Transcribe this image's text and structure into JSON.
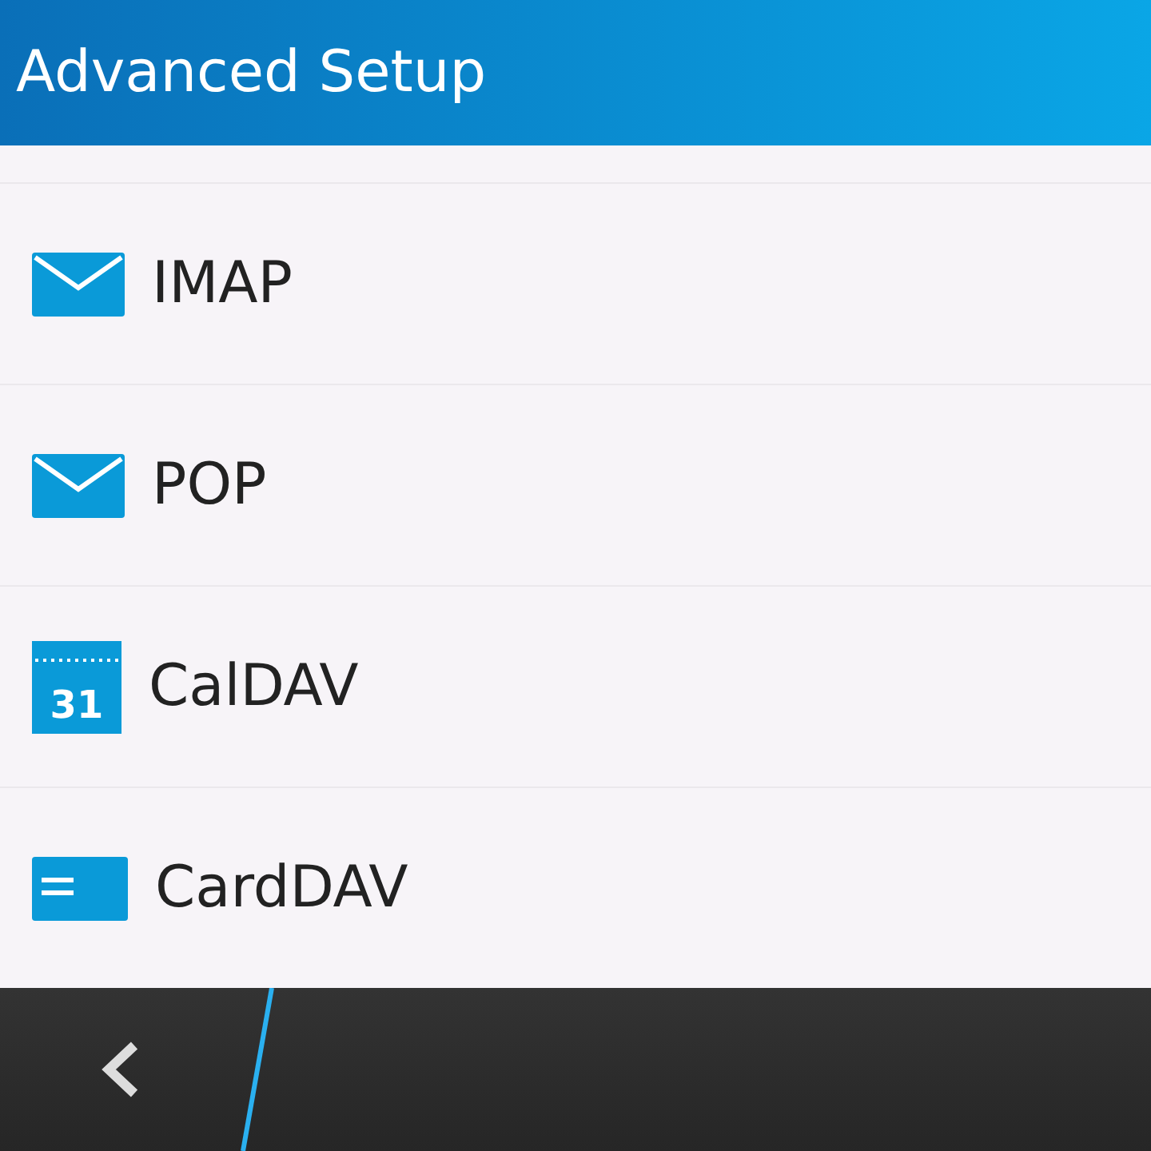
{
  "header": {
    "title": "Advanced Setup"
  },
  "items": [
    {
      "kind": "mail",
      "label": "IMAP"
    },
    {
      "kind": "mail",
      "label": "POP"
    },
    {
      "kind": "calendar",
      "label": "CalDAV",
      "icon_text": "31"
    },
    {
      "kind": "card",
      "label": "CardDAV"
    }
  ],
  "action_bar": {
    "back": true
  }
}
